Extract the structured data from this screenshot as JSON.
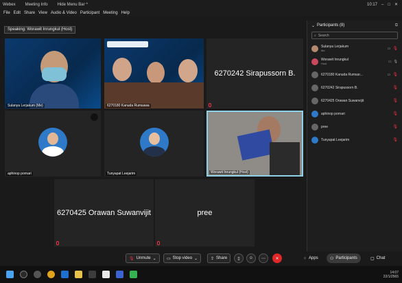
{
  "titlebar": {
    "app": "Webex",
    "meeting_info": "Meeting Info",
    "hide_menu": "Hide Menu Bar ^",
    "time": "10:17"
  },
  "menu": [
    "File",
    "Edit",
    "Share",
    "View",
    "Audio & Video",
    "Participant",
    "Meeting",
    "Help"
  ],
  "speaking": "Speaking: Worawit Inrungkul (Host)",
  "tiles": {
    "t1": "Sulanya Lerjakum (Me)",
    "t2": "6270180 Kanuda Rumsawa",
    "t3_big": "6270242 Sirapussorn B.",
    "t4": "aphinop pornari",
    "t5": "Tunyapat Leejarim",
    "t6": "Worawit Inrungkul (Host)",
    "t7_big": "6270425 Orawan Suwanvijit",
    "t8_big": "pree"
  },
  "panel": {
    "title": "Participants (8)",
    "search": "Search",
    "rows": [
      {
        "name": "Sulanya Lerjakum",
        "sub": "Me"
      },
      {
        "name": "Worawit Inrungkul",
        "sub": "Host"
      },
      {
        "name": "6270180 Kanuda Rumsar...",
        "sub": ""
      },
      {
        "name": "6270242 Sirapussorn B.",
        "sub": ""
      },
      {
        "name": "6270425 Orawan Suwanvijit",
        "sub": ""
      },
      {
        "name": "aphinop pornari",
        "sub": ""
      },
      {
        "name": "pree",
        "sub": ""
      },
      {
        "name": "Tunyapat Leejarim",
        "sub": ""
      }
    ]
  },
  "controls": {
    "unmute": "Unmute",
    "stop_video": "Stop video",
    "share": "Share",
    "apps": "Apps",
    "participants": "Participants",
    "chat": "Chat"
  },
  "taskbar": {
    "time": "14:07",
    "date": "22/1/2565"
  },
  "colors": {
    "end_red": "#e02828",
    "accent_blue": "#2e79c8"
  }
}
